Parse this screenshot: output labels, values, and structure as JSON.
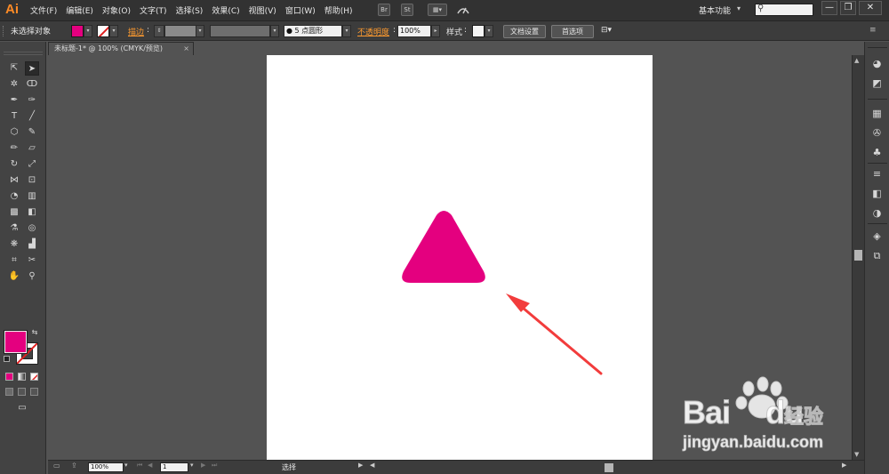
{
  "app": {
    "logo": "Ai",
    "menu": [
      "文件(F)",
      "编辑(E)",
      "对象(O)",
      "文字(T)",
      "选择(S)",
      "效果(C)",
      "视图(V)",
      "窗口(W)",
      "帮助(H)"
    ],
    "menubar_box_br": "Br",
    "menubar_box_st": "St",
    "workspace": "基本功能",
    "workspace_arrow": "▾",
    "window_buttons": [
      "—",
      "❐",
      "✕"
    ]
  },
  "control_bar": {
    "selection_label": "未选择对象",
    "fill_color": "#e4007f",
    "stroke_label": "描边",
    "brush_value": "5 点圆形",
    "opacity_label": "不透明度",
    "opacity_value": "100%",
    "style_label": "样式",
    "doc_setup_button": "文档设置",
    "preferences_button": "首选项"
  },
  "document": {
    "tab_title": "未标题-1* @ 100% (CMYK/预览)",
    "tab_close": "×",
    "shape_color": "#e4007f",
    "arrow_color": "#f23c3c"
  },
  "status_bar": {
    "zoom": "100%",
    "page": "1",
    "status_text": "选择"
  },
  "watermark": {
    "brand_bai": "Bai",
    "brand_du": "du",
    "brand_cn": "经验",
    "url": "jingyan.baidu.com"
  },
  "colors": {
    "fill": "#e4007f",
    "stroke": "#ffffff",
    "ui_dark": "#323232",
    "ui_mid": "#535353",
    "accent_orange": "#ff9b2f"
  }
}
